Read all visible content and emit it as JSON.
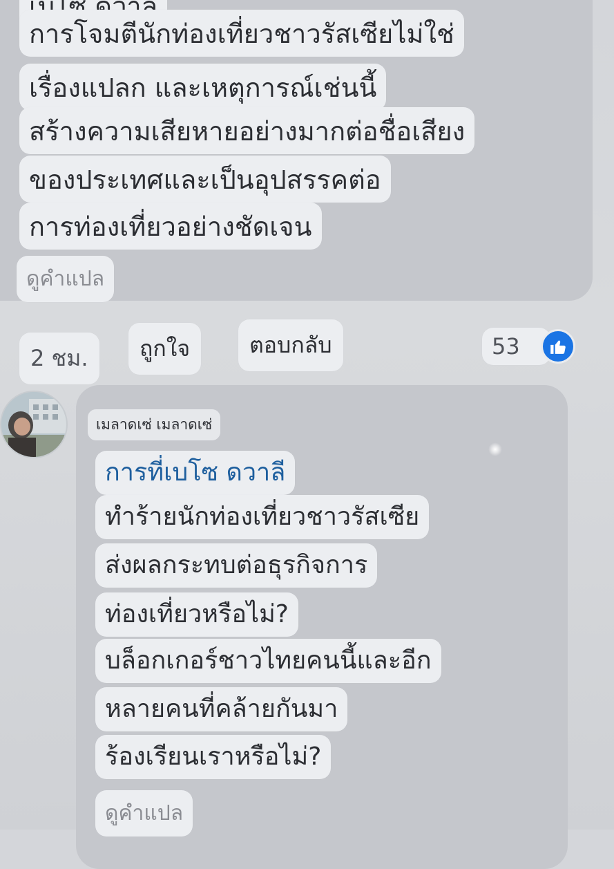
{
  "comment1": {
    "cut_text": "เบโซ ดวาลี",
    "lines": [
      "การโจมตีนักท่องเที่ยวชาวรัสเซียไม่ใช่",
      "เรื่องแปลก และเหตุการณ์เช่นนี้",
      "สร้างความเสียหายอย่างมากต่อชื่อเสียง",
      "ของประเทศและเป็นอุปสรรคต่อ",
      "การท่องเที่ยวอย่างชัดเจน"
    ],
    "translate_label": "ดูคำแปล"
  },
  "actions": {
    "time": "2 ชม.",
    "like_label": "ถูกใจ",
    "reply_label": "ตอบกลับ",
    "like_count": "53"
  },
  "comment2": {
    "author": "เมลาดเซ่ เมลาดเซ่",
    "lines": [
      "การที่เบโซ ดวาลี",
      "ทำร้ายนักท่องเที่ยวชาวรัสเซีย",
      "ส่งผลกระทบต่อธุรกิจการ",
      "ท่องเที่ยวหรือไม่?",
      "บล็อกเกอร์ชาวไทยคนนี้และอีก",
      "หลายคนที่คล้ายกันมา",
      "ร้องเรียนเราหรือไม่?"
    ],
    "translate_label": "ดูคำแปล"
  },
  "colors": {
    "accent": "#1a74e4",
    "link": "#1e5f9e",
    "bubble": "#eceef1",
    "panel": "#c5c7cc"
  }
}
